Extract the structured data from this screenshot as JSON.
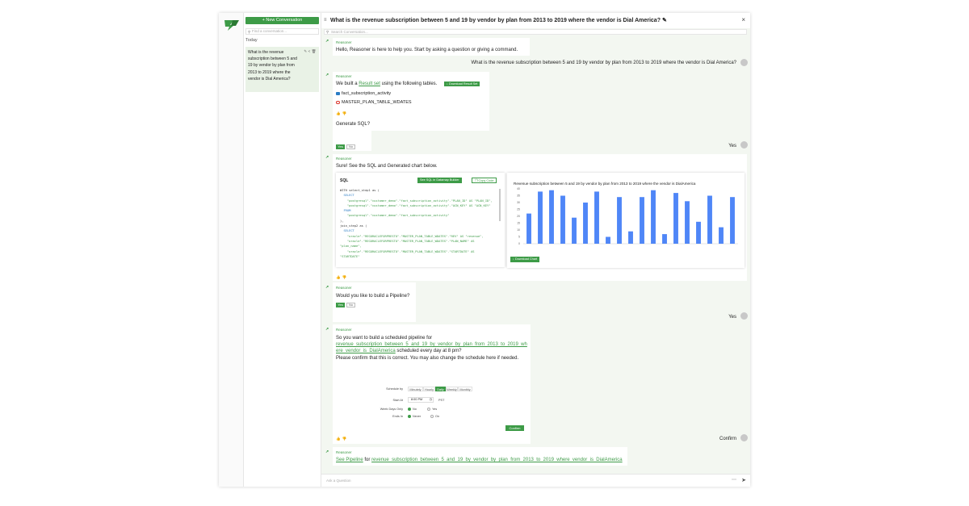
{
  "sidebar": {
    "new_conversation": "+ New Conversation",
    "find_placeholder": "Find a conversation...",
    "group_label": "Today",
    "conversations": [
      {
        "title": "What is the revenue subscription between 5 and 19 by vendor by plan from 2013 to 2019 where the vendor is Dial America?"
      }
    ]
  },
  "header": {
    "title": "What is the revenue subscription between 5 and 19 by vendor by plan from 2013 to 2019 where the vendor is Dial America?",
    "search_placeholder": "Search Conversation..."
  },
  "messages": {
    "bot_name": "Reasoner",
    "welcome": "Hello, Reasoner is here to help you. Start by asking a question or giving a command.",
    "user_question": "What is the revenue subscription between 5 and 19 by vendor by plan from 2013 to 2019 where the vendor is Dial America?",
    "built_prefix": "We built a",
    "built_link": "Result set",
    "built_suffix": "using the following tables.",
    "download_result_set": "Download Result Set",
    "tables": [
      "fact_subscription_activity",
      "MASTER_PLAN_TABLE_WDATES"
    ],
    "generate_sql": "Generate SQL?",
    "yes": "Yes",
    "no": "No",
    "user_yes": "Yes",
    "sql_intro": "Sure! See the SQL and Generated chart below.",
    "sql_title": "SQL",
    "see_sql_builder": "See SQL in Datamap Builder",
    "copy_code": "Copy Code",
    "chart_download": "Download Chart",
    "pipeline_question": "Would you like to build a Pipeline?",
    "user_yes_2": "Yes",
    "schedule_intro": "So you want to build a scheduled pipeline for",
    "schedule_link": "revenue_subscription_between_5_and_19_by_vendor_by_plan_from_2013_to_2019_where_vendor_is_DialAmerica",
    "schedule_suffix": "scheduled every day at 8 pm?",
    "schedule_confirm": "Please confirm that this is correct. You may also change the schedule here if needed.",
    "user_confirm": "Confirm",
    "see_pipeline": "See Pipeline",
    "for_word": "for",
    "pipeline_link": "revenue_subscription_between_5_and_19_by_vendor_by_plan_from_2013_to_2019_where_vendor_is_DialAmerica"
  },
  "sql_lines": [
    {
      "t": "WITH select_step1 as (",
      "c": "plain"
    },
    {
      "t": "  SELECT",
      "c": "kw"
    },
    {
      "t": "    \"postgresql\".\"customer_demo\".\"fact_subscription_activity\".\"PLAN_ID\" AS \"PLAN_ID\",",
      "c": "str"
    },
    {
      "t": "    \"postgresql\".\"customer_demo\".\"fact_subscription_activity\".\"ACN_KEY\" AS \"ACN_KEY\"",
      "c": "str"
    },
    {
      "t": "  FROM",
      "c": "kw"
    },
    {
      "t": "    \"postgresql\".\"customer_demo\".\"fact_subscription_activity\"",
      "c": "str"
    },
    {
      "t": "),",
      "c": "plain"
    },
    {
      "t": "join_step2 as (",
      "c": "plain"
    },
    {
      "t": "  SELECT",
      "c": "kw"
    },
    {
      "t": "    \"oracle\".\"REGORACLEFORPRESTO\".\"MASTER_PLAN_TABLE_WDATES\".\"REV\" AS \"revenue\",",
      "c": "str"
    },
    {
      "t": "    \"oracle\".\"REGORACLEFORPRESTO\".\"MASTER_PLAN_TABLE_WDATES\".\"PLAN_NAME\" AS",
      "c": "str"
    },
    {
      "t": "\"plan_name\",",
      "c": "str"
    },
    {
      "t": "    \"oracle\".\"REGORACLEFORPRESTO\".\"MASTER_PLAN_TABLE_WDATES\".\"STARTDATE\" AS",
      "c": "str"
    },
    {
      "t": "\"STARTDATE\"",
      "c": "str"
    }
  ],
  "schedule_form": {
    "schedule_by_label": "Schedule by",
    "options": [
      "Minutely",
      "Hourly",
      "Daily",
      "Weekly",
      "Monthly"
    ],
    "selected": "Daily",
    "start_at_label": "Start At",
    "start_at_value": "8:00 PM",
    "timezone": "PST",
    "weekdays_label": "Week Days Only",
    "weekdays_options": [
      "No",
      "Yes"
    ],
    "weekdays_selected": "No",
    "ends_label": "Ends In",
    "ends_options": [
      "Never",
      "On"
    ],
    "ends_selected": "Never",
    "confirm": "Confirm"
  },
  "input": {
    "placeholder": "Ask a Question",
    "more_icon": "more-icon",
    "send_icon": "send-icon"
  },
  "colors": {
    "accent": "#3d9b47",
    "bar": "#4f86f7"
  },
  "chart_data": {
    "type": "bar",
    "title": "Revenue subscription between 5 and 19 by vendor by plan from 2013 to 2019 where the vendor is DialAmerica",
    "ylim": [
      0,
      40
    ],
    "yticks": [
      0,
      5,
      10,
      15,
      20,
      25,
      30,
      35,
      40
    ],
    "values": [
      22,
      38,
      39,
      35,
      19,
      30,
      38,
      5,
      34,
      9,
      34,
      39,
      7,
      37,
      31,
      16,
      35,
      12,
      34
    ],
    "grid": false,
    "legend": "none"
  }
}
